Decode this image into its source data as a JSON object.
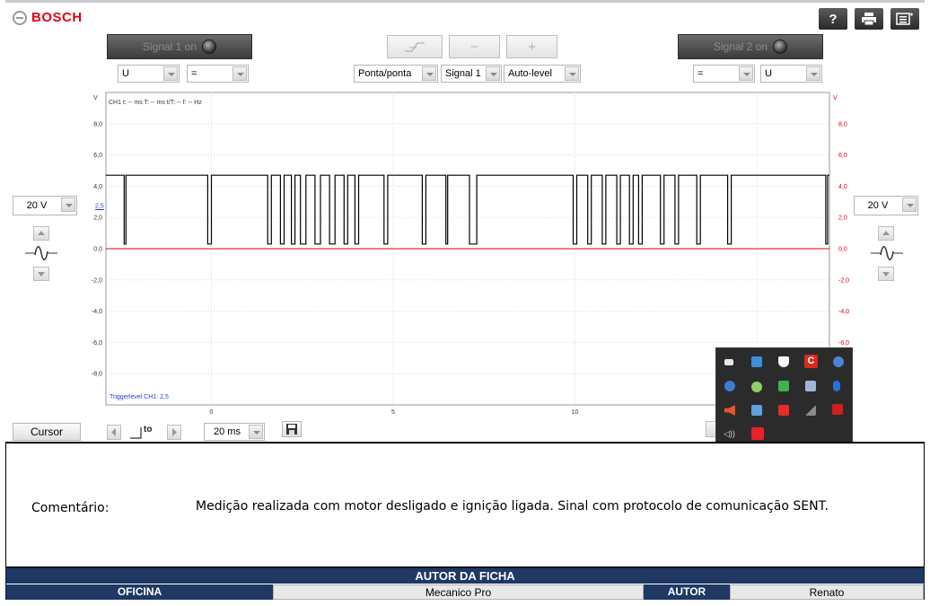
{
  "brand": {
    "name": "BOSCH"
  },
  "toolbar": {
    "help_icon": "?",
    "print_icon": "printer-icon",
    "menu_icon": "menu-icon"
  },
  "signal1": {
    "label": "Signal 1 on"
  },
  "signal2": {
    "label": "Signal 2 on"
  },
  "trigger": {
    "edge_icon": "trigger-edge-icon",
    "minus": "−",
    "plus": "+"
  },
  "left_selects": {
    "quantity": "U",
    "coupling": "="
  },
  "center_selects": {
    "mode": "Ponta/ponta",
    "source": "Signal 1",
    "level": "Auto-level"
  },
  "right_selects": {
    "coupling": "=",
    "quantity": "U"
  },
  "left_range": "20 V",
  "right_range": "20 V",
  "chart_data": {
    "type": "line",
    "header": "CH1  t: -- ms   T: -- ms   t/T: --   f: -- Hz",
    "y_unit_left": "V",
    "y_unit_right": "V",
    "y_ticks": [
      "8,0",
      "6,0",
      "4,0",
      "2,0",
      "0,0",
      "-2,0",
      "-4,0",
      "-6,0",
      "-8,0"
    ],
    "y_tick_values": [
      8,
      6,
      4,
      2,
      0,
      -2,
      -4,
      -6,
      -8
    ],
    "right_ticks": [
      "8,0",
      "6,0",
      "4,0",
      "2,0",
      "0,0",
      "-2,0",
      "-4,0",
      "-6,0"
    ],
    "right_tick_values": [
      8,
      6,
      4,
      2,
      0,
      -2,
      -4,
      -6
    ],
    "x_ticks": [
      "0",
      "5",
      "10"
    ],
    "x_tick_values": [
      0,
      5,
      10
    ],
    "ylim": [
      -10,
      10
    ],
    "xlim": [
      -2.9,
      17
    ],
    "trigger_level_label": "2,5",
    "trigger_level": 2.5,
    "trigger_text": "Triggerlevel CH1: 2,5",
    "high_level": 4.7,
    "low_level": 0.3,
    "low_pulses": [
      [
        -2.4,
        -2.35
      ],
      [
        -0.1,
        0.0
      ],
      [
        1.55,
        1.65
      ],
      [
        1.9,
        2.0
      ],
      [
        2.2,
        2.3
      ],
      [
        2.45,
        2.6
      ],
      [
        2.85,
        3.0
      ],
      [
        3.25,
        3.4
      ],
      [
        3.65,
        3.75
      ],
      [
        3.95,
        4.05
      ],
      [
        4.75,
        4.85
      ],
      [
        5.8,
        5.9
      ],
      [
        6.45,
        6.5
      ],
      [
        7.1,
        7.3
      ],
      [
        9.95,
        10.05
      ],
      [
        10.35,
        10.45
      ],
      [
        10.75,
        10.85
      ],
      [
        11.15,
        11.25
      ],
      [
        11.5,
        11.6
      ],
      [
        11.75,
        11.85
      ],
      [
        12.35,
        12.45
      ],
      [
        12.75,
        12.85
      ],
      [
        13.35,
        13.45
      ],
      [
        14.2,
        14.3
      ],
      [
        16.9,
        16.95
      ]
    ]
  },
  "bottom": {
    "cursor": "Cursor",
    "timebase": "20 ms",
    "trigger_pos_icon": "trigger-position-icon",
    "save_icon": "save-icon"
  },
  "comment": {
    "label": "Comentário:",
    "text": "Medição realizada com motor desligado e ignição ligada. Sinal com protocolo de comunicação SENT."
  },
  "author": {
    "title": "AUTOR DA FICHA",
    "workshop_label": "OFICINA",
    "workshop_value": "Mecanico Pro",
    "author_label": "AUTOR",
    "author_value": "Renato"
  },
  "colors": {
    "brand_red": "#e2001a",
    "header_navy": "#1f3864",
    "signal_black": "#000000",
    "right_axis_red": "#e2001a",
    "trigger_blue": "#1f3bd1"
  }
}
